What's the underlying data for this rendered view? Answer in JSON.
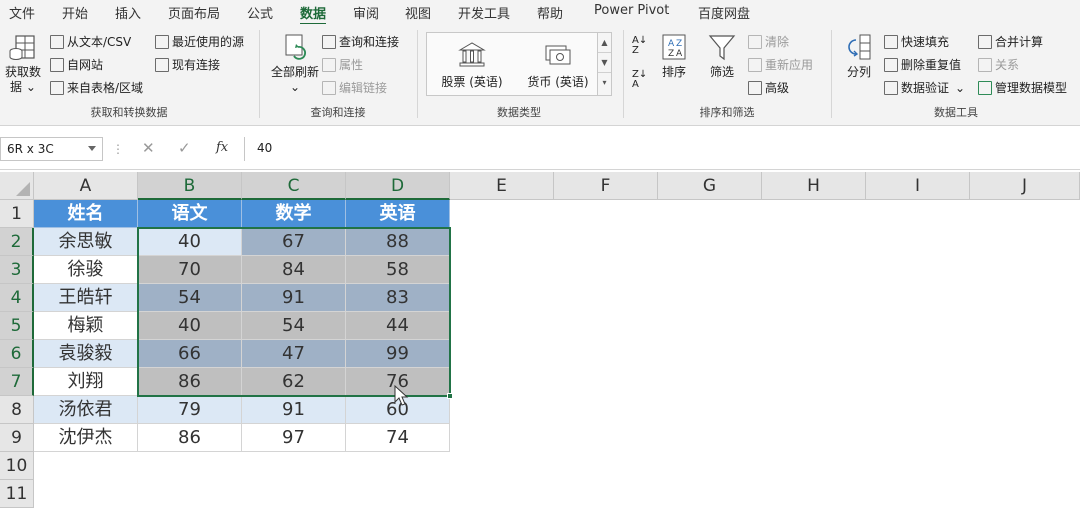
{
  "menu": {
    "tabs": [
      "文件",
      "开始",
      "插入",
      "页面布局",
      "公式",
      "数据",
      "审阅",
      "视图",
      "开发工具",
      "帮助",
      "Power Pivot",
      "百度网盘"
    ],
    "active": "数据"
  },
  "ribbon": {
    "get_transform": {
      "label": "获取和转换数据",
      "get_data_line1": "获取数",
      "get_data_line2": "据",
      "from_text": "从文本/CSV",
      "from_web": "自网站",
      "from_table": "来自表格/区域",
      "recent_sources": "最近使用的源",
      "existing_connections": "现有连接"
    },
    "queries": {
      "label": "查询和连接",
      "refresh_all": "全部刷新",
      "queries_connections": "查询和连接",
      "properties": "属性",
      "edit_links": "编辑链接"
    },
    "data_types": {
      "label": "数据类型",
      "stocks": "股票 (英语)",
      "currencies": "货币 (英语)"
    },
    "sort_filter": {
      "label": "排序和筛选",
      "sort": "排序",
      "filter": "筛选",
      "clear": "清除",
      "reapply": "重新应用",
      "advanced": "高级"
    },
    "data_tools": {
      "label": "数据工具",
      "text_to_columns": "分列",
      "flash_fill": "快速填充",
      "remove_duplicates": "删除重复值",
      "data_validation": "数据验证",
      "consolidate": "合并计算",
      "relationships": "关系",
      "manage_data_model": "管理数据模型"
    }
  },
  "formula_bar": {
    "name_box": "6R x 3C",
    "fx": "fx",
    "value": "40"
  },
  "sheet": {
    "columns": [
      "A",
      "B",
      "C",
      "D",
      "E",
      "F",
      "G",
      "H",
      "I",
      "J"
    ],
    "rows": [
      "1",
      "2",
      "3",
      "4",
      "5",
      "6",
      "7",
      "8",
      "9",
      "10",
      "11"
    ],
    "header": [
      "姓名",
      "语文",
      "数学",
      "英语"
    ],
    "data": [
      [
        "余思敏",
        "40",
        "67",
        "88"
      ],
      [
        "徐骏",
        "70",
        "84",
        "58"
      ],
      [
        "王皓轩",
        "54",
        "91",
        "83"
      ],
      [
        "梅颖",
        "40",
        "54",
        "44"
      ],
      [
        "袁骏毅",
        "66",
        "47",
        "99"
      ],
      [
        "刘翔",
        "86",
        "62",
        "76"
      ],
      [
        "汤依君",
        "79",
        "91",
        "60"
      ],
      [
        "沈伊杰",
        "86",
        "97",
        "74"
      ]
    ]
  },
  "colors": {
    "accent": "#217346",
    "header_fill": "#4a90d9",
    "band_fill": "#dce8f5"
  }
}
